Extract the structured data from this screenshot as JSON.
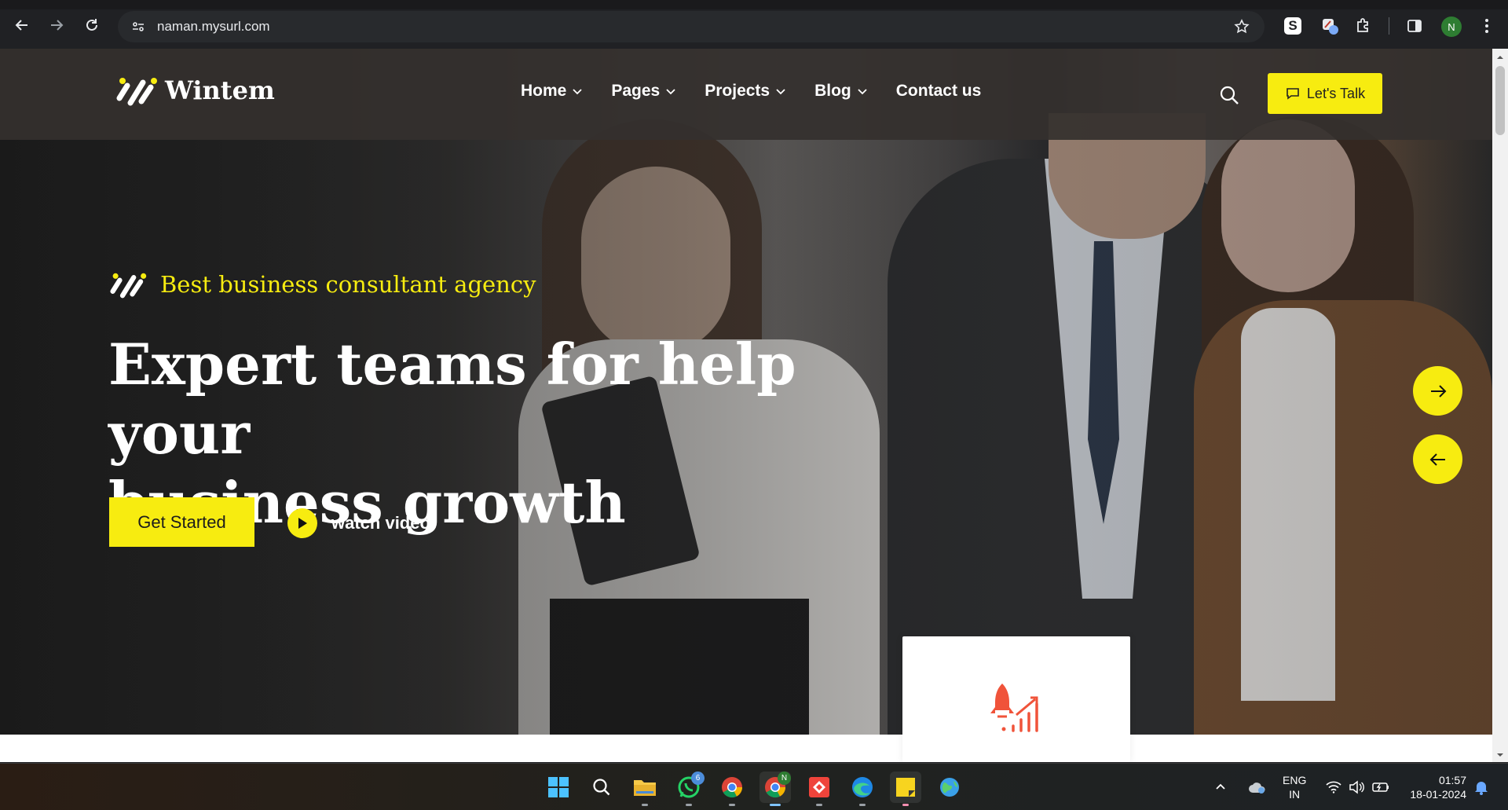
{
  "browser": {
    "url": "naman.mysurl.com",
    "profile_initial": "N",
    "extension_s_label": "S"
  },
  "site": {
    "logo_text": "Wintem",
    "nav": [
      {
        "label": "Home"
      },
      {
        "label": "Pages"
      },
      {
        "label": "Projects"
      },
      {
        "label": "Blog"
      },
      {
        "label": "Contact us"
      }
    ],
    "cta_label": "Let's Talk",
    "accent_color": "#f7ec10"
  },
  "hero": {
    "tagline": "Best business consultant agency",
    "headline_line1": "Expert teams for help your",
    "headline_line2": "business growth",
    "primary_button": "Get Started",
    "video_link": "watch video"
  },
  "taskbar": {
    "whatsapp_badge": "6",
    "chrome_profile_badge": "N",
    "lang_line1": "ENG",
    "lang_line2": "IN",
    "time": "01:57",
    "date": "18-01-2024"
  }
}
